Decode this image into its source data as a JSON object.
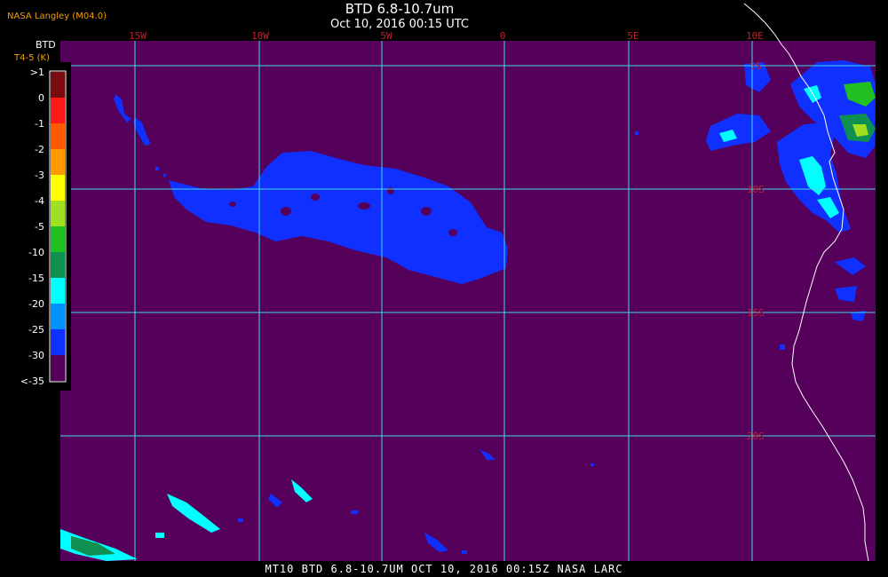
{
  "credit": "NASA Langley (M04.0)",
  "title": "BTD 6.8-10.7um",
  "subtitle": "Oct 10, 2016 00:15 UTC",
  "legend": {
    "title": "BTD",
    "subtitle": "T4-5 (K)",
    "items": [
      {
        "label": ">1",
        "color": "#7a0c10"
      },
      {
        "label": "0",
        "color": "#ff1a1a"
      },
      {
        "label": "-1",
        "color": "#ff5a00"
      },
      {
        "label": "-2",
        "color": "#ff9a00"
      },
      {
        "label": "-3",
        "color": "#ffff00"
      },
      {
        "label": "-4",
        "color": "#a0e020"
      },
      {
        "label": "-5",
        "color": "#20c020"
      },
      {
        "label": "-10",
        "color": "#109050"
      },
      {
        "label": "-15",
        "color": "#00ffff"
      },
      {
        "label": "-20",
        "color": "#0090ff"
      },
      {
        "label": "-25",
        "color": "#1030ff"
      },
      {
        "label": "-30",
        "color": "#55005a"
      },
      {
        "label": "<-35",
        "color": "#55005a"
      }
    ]
  },
  "colors": {
    "background": "#55005a",
    "grid": "#40d8e8",
    "grid_label": "#c0202a",
    "coastline": "#ffffff",
    "cloud_blue": "#1030ff"
  },
  "longitude_labels": [
    "15W",
    "10W",
    "5W",
    "0",
    "5E",
    "10E"
  ],
  "latitude_labels": [
    "5S",
    "10S",
    "15S",
    "20S"
  ],
  "footer": "MT10  BTD 6.8-10.7UM  OCT 10, 2016 00:15Z  NASA LARC"
}
